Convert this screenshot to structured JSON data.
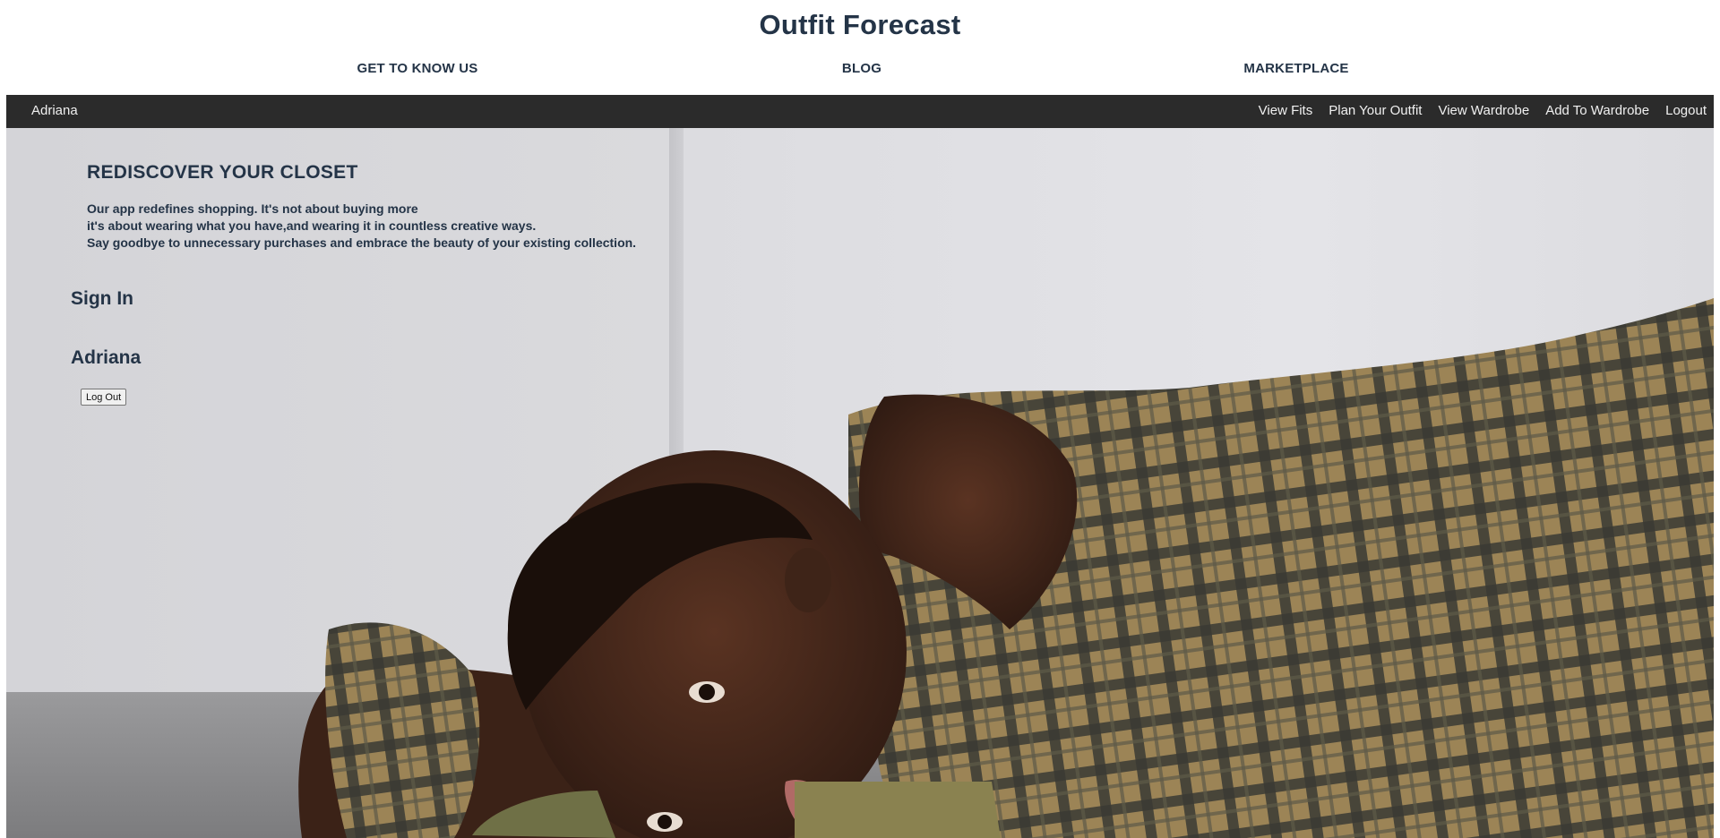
{
  "site": {
    "title": "Outfit Forecast"
  },
  "top_nav": {
    "about": "GET TO KNOW US",
    "blog": "BLOG",
    "marketplace": "MARKETPLACE"
  },
  "app_bar": {
    "user_name": "Adriana",
    "links": {
      "view_fits": "View Fits",
      "plan_outfit": "Plan Your Outfit",
      "view_wardrobe": "View Wardrobe",
      "add_wardrobe": "Add To Wardrobe",
      "logout": "Logout"
    }
  },
  "hero": {
    "heading": "REDISCOVER YOUR CLOSET",
    "lines": [
      "Our app redefines shopping. It's not about buying more",
      "it's about wearing what you have,and wearing it in countless creative ways.",
      "Say goodbye to unnecessary purchases and embrace the beauty of your existing collection."
    ]
  },
  "auth": {
    "sign_in_heading": "Sign In",
    "user_heading": "Adriana",
    "logout_button": "Log Out"
  },
  "colors": {
    "text_primary": "#243447",
    "app_bar_bg": "#2b2b2b",
    "plaid_base": "#9c8456",
    "skin": "#4a2a1c"
  }
}
